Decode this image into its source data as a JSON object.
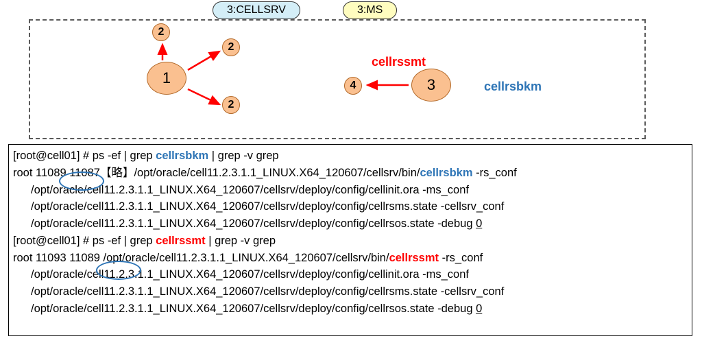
{
  "labels": {
    "cellsrv": "3:CELLSRV",
    "ms": "3:MS",
    "cellrssmt": "cellrssmt",
    "cellrsbkm": "cellrsbkm"
  },
  "nodes": {
    "n1": "1",
    "n2a": "2",
    "n2b": "2",
    "n2c": "2",
    "n3": "3",
    "n4": "4"
  },
  "terminal": {
    "prompt1_a": "[root@cell01] # ps -ef | grep ",
    "prompt1_b": "cellrsbkm",
    "prompt1_c": " | grep -v grep",
    "row1_a": "root      ",
    "row1_pid": "11089",
    "row1_b": " 11087【略】/opt/oracle/cell11.2.3.1.1_LINUX.X64_120607/cellsrv/bin/",
    "row1_c": "cellrsbkm",
    "row1_d": " -rs_conf",
    "row1_l2": "/opt/oracle/cell11.2.3.1.1_LINUX.X64_120607/cellsrv/deploy/config/cellinit.ora -ms_conf",
    "row1_l3": "/opt/oracle/cell11.2.3.1.1_LINUX.X64_120607/cellsrv/deploy/config/cellrsms.state -cellsrv_conf",
    "row1_l4_a": "/opt/oracle/cell11.2.3.1.1_LINUX.X64_120607/cellsrv/deploy/config/cellrsos.state -debug ",
    "row1_l4_b": "0",
    "prompt2_a": "[root@cell01] # ps -ef | grep ",
    "prompt2_b": "cellrssmt",
    "prompt2_c": " | grep -v grep",
    "row2_a": "root      11093 ",
    "row2_ppid": "11089",
    "row2_b": " /opt/oracle/cell11.2.3.1.1_LINUX.X64_120607/cellsrv/bin/",
    "row2_c": "cellrssmt",
    "row2_d": " -rs_conf",
    "row2_l2": "/opt/oracle/cell11.2.3.1.1_LINUX.X64_120607/cellsrv/deploy/config/cellinit.ora -ms_conf",
    "row2_l3": "/opt/oracle/cell11.2.3.1.1_LINUX.X64_120607/cellsrv/deploy/config/cellrsms.state -cellsrv_conf",
    "row2_l4_a": "/opt/oracle/cell11.2.3.1.1_LINUX.X64_120607/cellsrv/deploy/config/cellrsos.state -debug ",
    "row2_l4_b": "0"
  },
  "colors": {
    "node_fill": "#fac090",
    "node_border": "#b36a2a",
    "arrow": "#ff0000",
    "blue": "#2e75b6",
    "red": "#ff0000",
    "cellsrv_bg": "#d4eef7",
    "ms_bg": "#fffdbf"
  }
}
